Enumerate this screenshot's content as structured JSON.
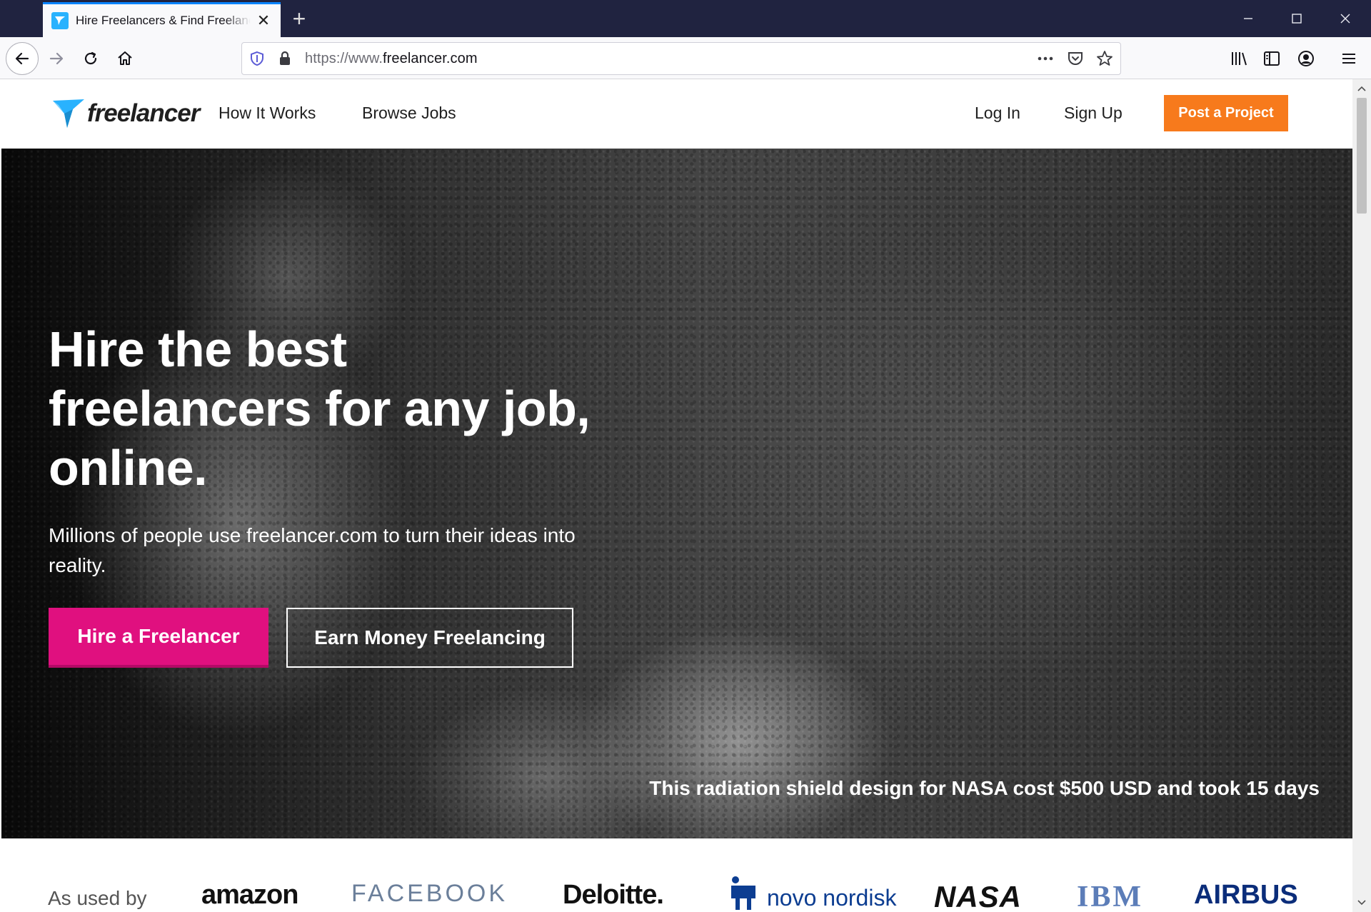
{
  "browser": {
    "tab_title": "Hire Freelancers & Find Freelance Jobs",
    "url_protocol": "https://www.",
    "url_domain": "freelancer.com"
  },
  "header": {
    "logo_text": "freelancer",
    "nav": [
      "How It Works",
      "Browse Jobs"
    ],
    "login": "Log In",
    "signup": "Sign Up",
    "post_project": "Post a Project"
  },
  "hero": {
    "title": "Hire the best freelancers for any job, online.",
    "subtitle": "Millions of people use freelancer.com to turn their ideas into reality.",
    "hire_button": "Hire a Freelancer",
    "earn_button": "Earn Money Freelancing",
    "caption": "This radiation shield design for NASA cost $500 USD and took 15 days"
  },
  "logos": {
    "label": "As used by",
    "brands": [
      "amazon",
      "FACEBOOK",
      "Deloitte.",
      "novo nordisk",
      "NASA",
      "IBM",
      "AIRBUS"
    ]
  },
  "colors": {
    "accent_orange": "#f77a1c",
    "accent_pink": "#e0107f",
    "logo_blue": "#29b2fe",
    "titlebar": "#202340"
  }
}
